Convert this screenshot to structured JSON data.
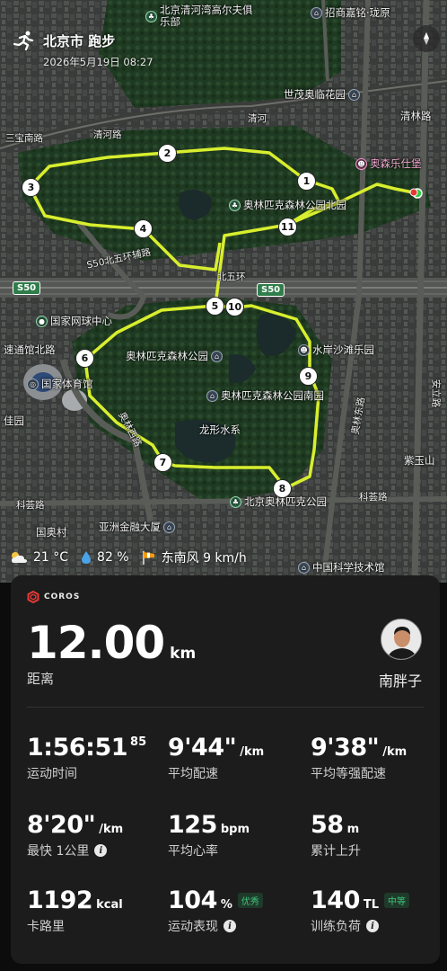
{
  "header": {
    "title": "北京市 跑步",
    "date": "2026年5月19日 08:27"
  },
  "map": {
    "pois": {
      "qinghe_bay": "北京清河湾高尔夫俱乐部",
      "zhaoshang": "招商嘉铭·珑原",
      "shimao": "世茂奥临花园",
      "qinglin": "清林路",
      "aosenle": "奥森乐仕堡",
      "forest_north": "奥林匹克森林公园北园",
      "tennis": "国家网球中心",
      "forest_park": "奥林匹克森林公园",
      "shuian": "水岸沙滩乐园",
      "forest_south": "奥林匹克森林公园南园",
      "sports_hall": "国家体育馆",
      "dragon_lake": "龙形水系",
      "olympic_park": "北京奥林匹克公园",
      "asia_finance": "亚洲金融大厦",
      "sci_museum": "中国科学技术馆",
      "guoao": "国奥村",
      "jiayu": "佳园",
      "zi_yu": "紫玉山",
      "sutong": "速通馆北路"
    },
    "roads": {
      "qinghe": "清河路",
      "qinghe2": "清河",
      "sanbao": "三宝南路",
      "s50_north": "S50北五环辅路",
      "north5": "北五环",
      "aolin_west": "奥林西路",
      "aolin_east": "奥林东路",
      "kecai": "科荟路",
      "kecai2": "科荟路",
      "anli": "安立路",
      "s50": "S50"
    },
    "markers": [
      "1",
      "2",
      "3",
      "4",
      "5",
      "6",
      "7",
      "8",
      "9",
      "10",
      "11"
    ]
  },
  "weather": {
    "temp": "21 °C",
    "humidity": "82 %",
    "wind": "东南风 9 km/h"
  },
  "card": {
    "brand": "COROS",
    "distance": "12.00",
    "distance_unit": "km",
    "distance_label": "距离",
    "username": "南胖子",
    "stats": {
      "time": {
        "value": "1:56:51",
        "sup": "85",
        "label": "运动时间"
      },
      "avg_pace": {
        "value": "9'44\"",
        "unit": "/km",
        "label": "平均配速"
      },
      "grade_pace": {
        "value": "9'38\"",
        "unit": "/km",
        "label": "平均等强配速"
      },
      "fastest_km": {
        "value": "8'20\"",
        "unit": "/km",
        "label": "最快 1公里"
      },
      "heart_rate": {
        "value": "125",
        "unit": "bpm",
        "label": "平均心率"
      },
      "ascent": {
        "value": "58",
        "unit": "m",
        "label": "累计上升"
      },
      "calories": {
        "value": "1192",
        "unit": "kcal",
        "label": "卡路里"
      },
      "performance": {
        "value": "104",
        "unit": "%",
        "badge": "优秀",
        "label": "运动表现"
      },
      "training_load": {
        "value": "140",
        "unit": "TL",
        "badge": "中等",
        "label": "训练负荷"
      }
    }
  },
  "colors": {
    "route": "#d8ee2e",
    "card_bg": "#1c1c1c",
    "badge_green": "#3fc47a"
  },
  "icons": [
    "runner-icon",
    "compass-icon",
    "weather-cloud-icon",
    "humidity-drop-icon",
    "wind-sock-icon",
    "coros-logo-icon",
    "info-icon"
  ]
}
